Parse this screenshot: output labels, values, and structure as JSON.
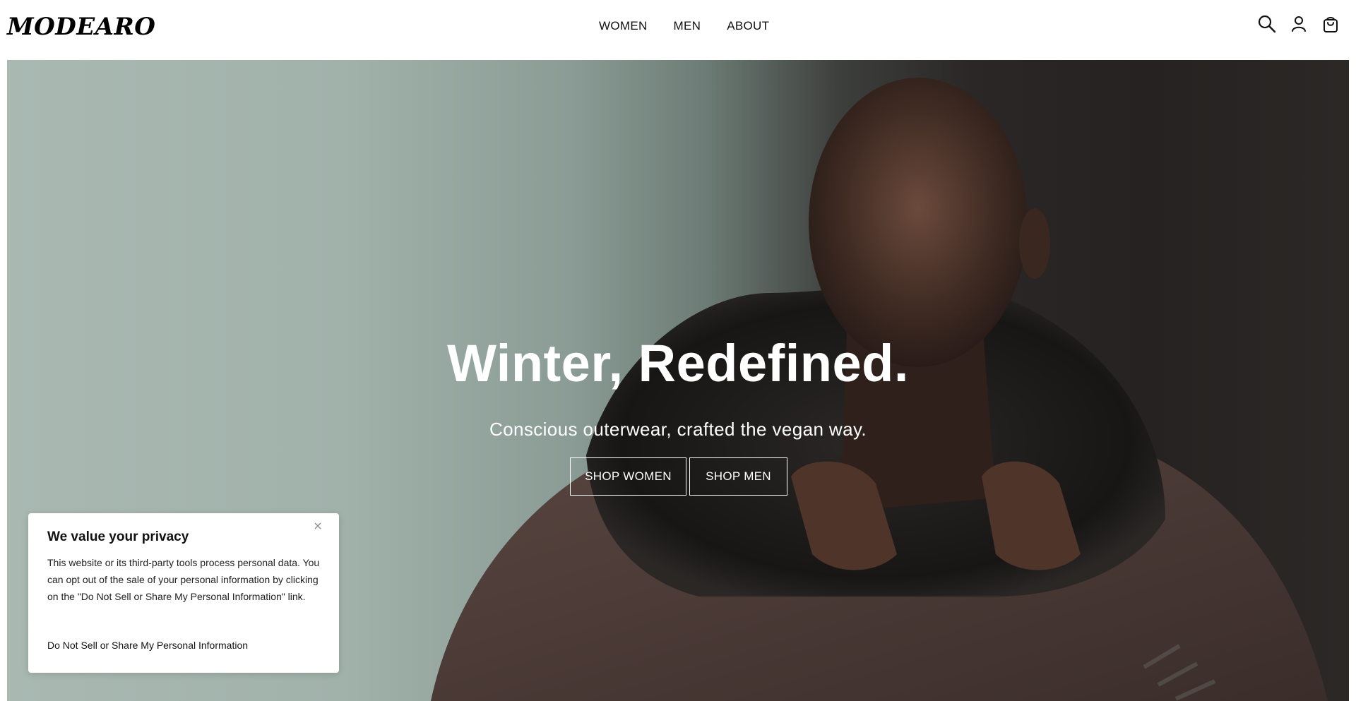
{
  "brand": {
    "logo_text": "MODEARO"
  },
  "nav": {
    "items": [
      {
        "label": "WOMEN"
      },
      {
        "label": "MEN"
      },
      {
        "label": "ABOUT"
      }
    ]
  },
  "header_icons": [
    "search-icon",
    "account-icon",
    "cart-icon"
  ],
  "hero": {
    "title": "Winter, Redefined.",
    "subtitle": "Conscious outerwear, crafted the vegan way.",
    "buttons": {
      "shop_women": "SHOP WOMEN",
      "shop_men": "SHOP MEN"
    }
  },
  "privacy_banner": {
    "title": "We value your privacy",
    "body": "This website or its third-party tools process personal data. You can opt out of the sale of your personal information by clicking on the \"Do Not Sell or Share My Personal Information\" link.",
    "link_label": "Do Not Sell or Share My Personal Information",
    "close_icon": "close-icon"
  },
  "colors": {
    "header_bg": "#ffffff",
    "text": "#111111",
    "hero_text": "#ffffff",
    "backdrop_light": "#a9b9b2",
    "backdrop_dark": "#252221"
  }
}
